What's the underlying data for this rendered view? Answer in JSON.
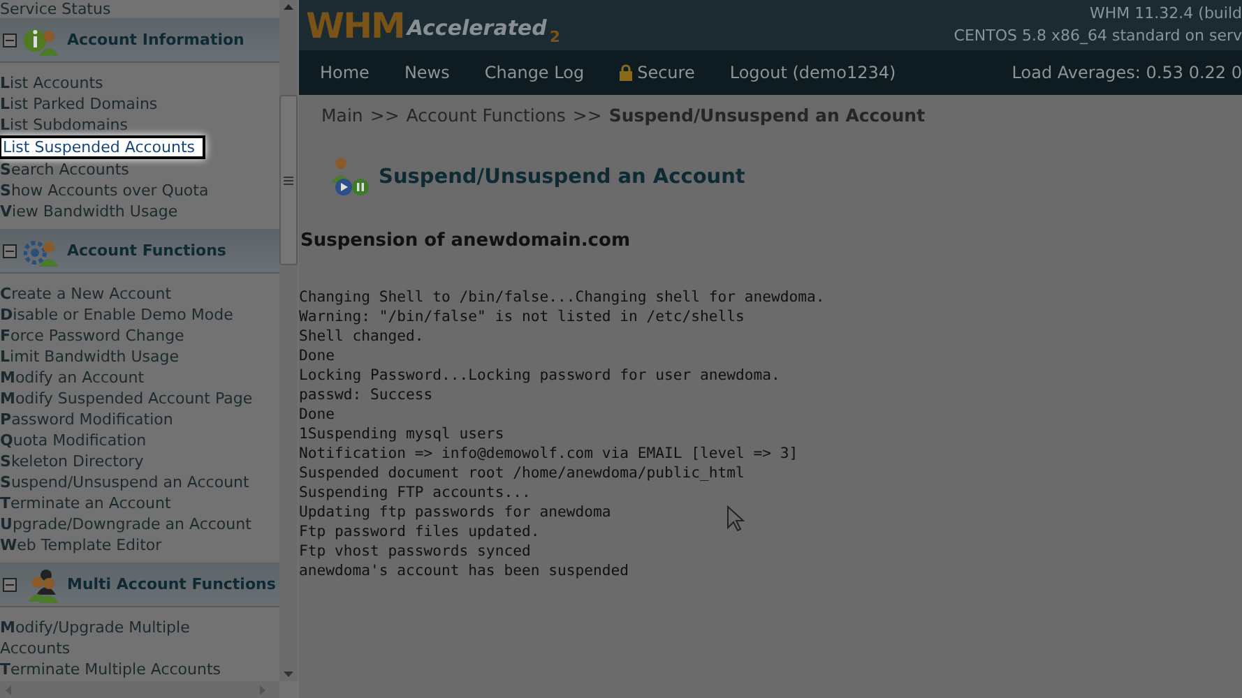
{
  "sidebar": {
    "top_item": "Service Status",
    "sections": [
      {
        "title": "Account Information",
        "expanded": true,
        "items": [
          {
            "label": "**L**ist Accounts",
            "selected": false
          },
          {
            "label": "**L**ist Parked Domains",
            "selected": false
          },
          {
            "label": "**L**ist Subdomains",
            "selected": false
          },
          {
            "label": "List Suspended Accounts",
            "selected": true
          },
          {
            "label": "**S**earch Accounts",
            "selected": false
          },
          {
            "label": "**S**how Accounts over Quota",
            "selected": false
          },
          {
            "label": "**V**iew Bandwidth Usage",
            "selected": false
          }
        ]
      },
      {
        "title": "Account Functions",
        "expanded": true,
        "items": [
          {
            "label": "**C**reate a New Account",
            "selected": false
          },
          {
            "label": "**D**isable or Enable Demo Mode",
            "selected": false
          },
          {
            "label": "**F**orce Password Change",
            "selected": false
          },
          {
            "label": "**L**imit Bandwidth Usage",
            "selected": false
          },
          {
            "label": "**M**odify an Account",
            "selected": false
          },
          {
            "label": "**M**odify Suspended Account Page",
            "selected": false
          },
          {
            "label": "**P**assword Modification",
            "selected": false
          },
          {
            "label": "**Q**uota Modification",
            "selected": false
          },
          {
            "label": "**S**keleton Directory",
            "selected": false
          },
          {
            "label": "**S**uspend/Unsuspend an Account",
            "selected": false
          },
          {
            "label": "**T**erminate an Account",
            "selected": false
          },
          {
            "label": "**U**pgrade/Downgrade an Account",
            "selected": false
          },
          {
            "label": "**W**eb Template Editor",
            "selected": false
          }
        ]
      },
      {
        "title": "Multi Account Functions",
        "expanded": true,
        "items": [
          {
            "label": "**M**odify/Upgrade Multiple Accounts",
            "selected": false
          },
          {
            "label": "**T**erminate Multiple Accounts",
            "selected": false
          }
        ]
      }
    ]
  },
  "header": {
    "logo": "WHM",
    "logo_sub": "Accelerated",
    "logo_version": "2",
    "version": "WHM 11.32.4 (build",
    "server": "CENTOS 5.8 x86_64 standard on serv"
  },
  "nav": {
    "items": [
      {
        "label": "Home",
        "kind": "link"
      },
      {
        "label": "News",
        "kind": "link"
      },
      {
        "label": "Change Log",
        "kind": "link"
      },
      {
        "label": "Secure",
        "kind": "secure"
      },
      {
        "label": "Logout (demo1234)",
        "kind": "link"
      }
    ],
    "load": "Load Averages: 0.53 0.22 0"
  },
  "breadcrumb": [
    "Main",
    ">>",
    "Account Functions",
    ">>",
    "Suspend/Unsuspend an Account"
  ],
  "page_title": "Suspend/Unsuspend an Account",
  "subtitle": "Suspension of anewdomain.com",
  "output": [
    "Changing Shell to /bin/false...Changing shell for anewdoma.",
    "Warning: \"/bin/false\" is not listed in /etc/shells",
    "Shell changed.",
    "Done",
    "Locking Password...Locking password for user anewdoma.",
    "passwd: Success",
    "Done",
    "1Suspending mysql users",
    "Notification => info@demowolf.com via EMAIL [level => 3]",
    "Suspended document root /home/anewdoma/public_html",
    "Suspending FTP accounts...",
    "Updating ftp passwords for anewdoma",
    "Ftp password files updated.",
    "Ftp vhost passwords synced",
    "anewdoma's account has been suspended"
  ]
}
